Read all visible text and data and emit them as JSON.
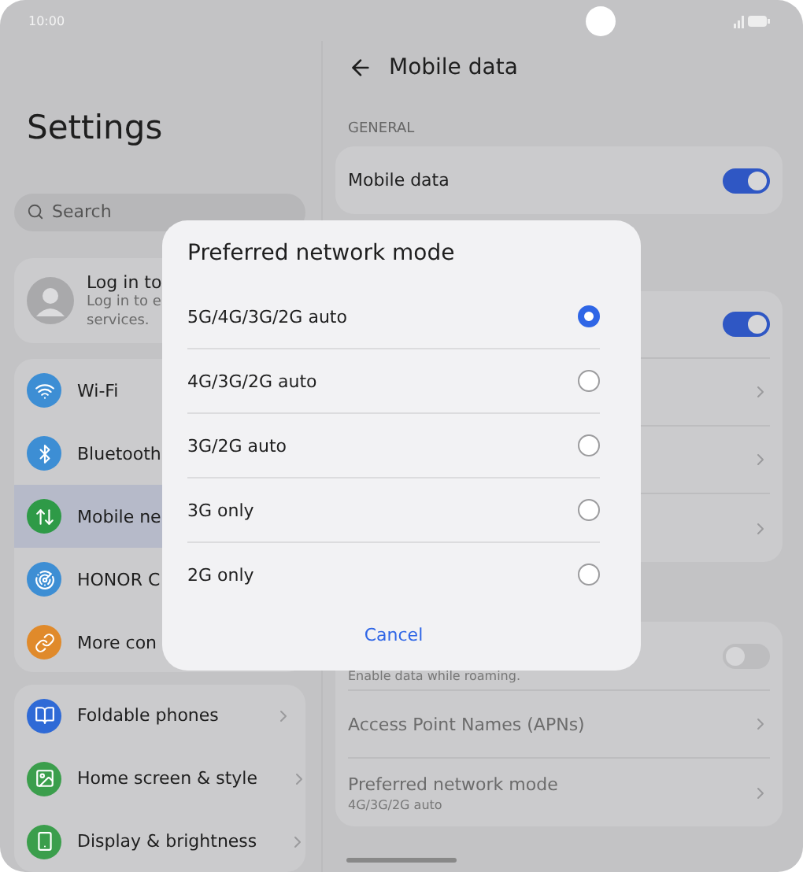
{
  "status_bar": {
    "time": "10:00"
  },
  "sidebar": {
    "title": "Settings",
    "search": {
      "placeholder": "Search"
    },
    "account": {
      "title": "Log in to",
      "lines": [
        "Log in to e",
        "services."
      ]
    },
    "groups": [
      {
        "chevrons": false,
        "items": [
          {
            "label": "Wi-Fi",
            "selected": false
          },
          {
            "label": "Bluetooth",
            "selected": false
          },
          {
            "label": "Mobile ne",
            "selected": true
          },
          {
            "label": "HONOR C",
            "selected": false
          },
          {
            "label": "More con",
            "selected": false
          }
        ]
      },
      {
        "chevrons": true,
        "items": [
          {
            "label": "Foldable phones",
            "selected": false
          },
          {
            "label": "Home screen & style",
            "selected": false
          },
          {
            "label": "Display & brightness",
            "selected": false
          }
        ]
      }
    ]
  },
  "panel": {
    "title": "Mobile data",
    "sections": [
      {
        "heading": "GENERAL",
        "rows": [
          {
            "kind": "toggle",
            "label": "Mobile data",
            "on": true
          }
        ]
      },
      {
        "rows": [
          {
            "kind": "toggle",
            "on": true
          },
          {
            "kind": "link"
          },
          {
            "kind": "link"
          },
          {
            "kind": "link"
          }
        ]
      },
      {
        "rows": [
          {
            "kind": "toggle",
            "subtitle": "Enable data while roaming.",
            "on": false
          },
          {
            "kind": "link",
            "label": "Access Point Names (APNs)"
          },
          {
            "kind": "link",
            "label": "Preferred network mode",
            "subtitle": "4G/3G/2G auto"
          }
        ]
      }
    ]
  },
  "dialog": {
    "title": "Preferred network mode",
    "options": [
      {
        "label": "5G/4G/3G/2G auto",
        "selected": true
      },
      {
        "label": "4G/3G/2G auto",
        "selected": false
      },
      {
        "label": "3G/2G auto",
        "selected": false
      },
      {
        "label": "3G only",
        "selected": false
      },
      {
        "label": "2G only",
        "selected": false
      }
    ],
    "cancel": "Cancel"
  }
}
